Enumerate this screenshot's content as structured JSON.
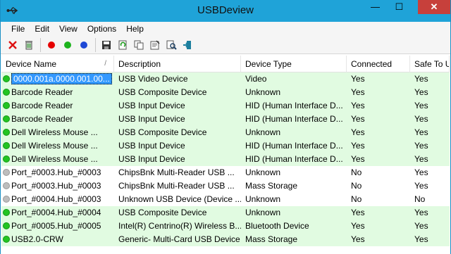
{
  "window": {
    "title": "USBDeview",
    "minimize": "—",
    "maximize": "☐",
    "close": "✕"
  },
  "menu": [
    "File",
    "Edit",
    "View",
    "Options",
    "Help"
  ],
  "toolbar": {
    "icons": [
      "disconnect-icon",
      "uninstall-icon",
      "red-dot-icon",
      "green-dot-icon",
      "blue-dot-icon",
      "save-icon",
      "refresh-icon",
      "copy-icon",
      "properties-icon",
      "find-icon",
      "exit-icon"
    ],
    "colors": {
      "red": "#e60000",
      "green": "#1db31d",
      "blue": "#1f49d6"
    }
  },
  "columns": [
    "Device Name",
    "Description",
    "Device Type",
    "Connected",
    "Safe To U"
  ],
  "colors": {
    "connected": "#22c422",
    "disconnected": "#bdbdbd",
    "selected": "#3399ff",
    "row_green": "#e1fbe1"
  },
  "rows": [
    {
      "name": "0000.001a.0000.001.00...",
      "desc": "USB Video Device",
      "type": "Video",
      "connected": "Yes",
      "safe": "Yes",
      "status": "connected",
      "selected": true
    },
    {
      "name": "Barcode Reader",
      "desc": "USB Composite Device",
      "type": "Unknown",
      "connected": "Yes",
      "safe": "Yes",
      "status": "connected"
    },
    {
      "name": "Barcode Reader",
      "desc": "USB Input Device",
      "type": "HID (Human Interface D...",
      "connected": "Yes",
      "safe": "Yes",
      "status": "connected"
    },
    {
      "name": "Barcode Reader",
      "desc": "USB Input Device",
      "type": "HID (Human Interface D...",
      "connected": "Yes",
      "safe": "Yes",
      "status": "connected"
    },
    {
      "name": "Dell Wireless Mouse ...",
      "desc": "USB Composite Device",
      "type": "Unknown",
      "connected": "Yes",
      "safe": "Yes",
      "status": "connected"
    },
    {
      "name": "Dell Wireless Mouse ...",
      "desc": "USB Input Device",
      "type": "HID (Human Interface D...",
      "connected": "Yes",
      "safe": "Yes",
      "status": "connected"
    },
    {
      "name": "Dell Wireless Mouse ...",
      "desc": "USB Input Device",
      "type": "HID (Human Interface D...",
      "connected": "Yes",
      "safe": "Yes",
      "status": "connected"
    },
    {
      "name": "Port_#0003.Hub_#0003",
      "desc": "ChipsBnk  Multi-Reader USB ...",
      "type": "Unknown",
      "connected": "No",
      "safe": "Yes",
      "status": "disconnected"
    },
    {
      "name": "Port_#0003.Hub_#0003",
      "desc": "ChipsBnk  Multi-Reader USB ...",
      "type": "Mass Storage",
      "connected": "No",
      "safe": "Yes",
      "status": "disconnected"
    },
    {
      "name": "Port_#0004.Hub_#0003",
      "desc": "Unknown USB Device (Device ...",
      "type": "Unknown",
      "connected": "No",
      "safe": "No",
      "status": "disconnected"
    },
    {
      "name": "Port_#0004.Hub_#0004",
      "desc": "USB Composite Device",
      "type": "Unknown",
      "connected": "Yes",
      "safe": "Yes",
      "status": "connected"
    },
    {
      "name": "Port_#0005.Hub_#0005",
      "desc": "Intel(R) Centrino(R) Wireless B...",
      "type": "Bluetooth Device",
      "connected": "Yes",
      "safe": "Yes",
      "status": "connected"
    },
    {
      "name": "USB2.0-CRW",
      "desc": "Generic- Multi-Card USB Device",
      "type": "Mass Storage",
      "connected": "Yes",
      "safe": "Yes",
      "status": "connected"
    }
  ]
}
